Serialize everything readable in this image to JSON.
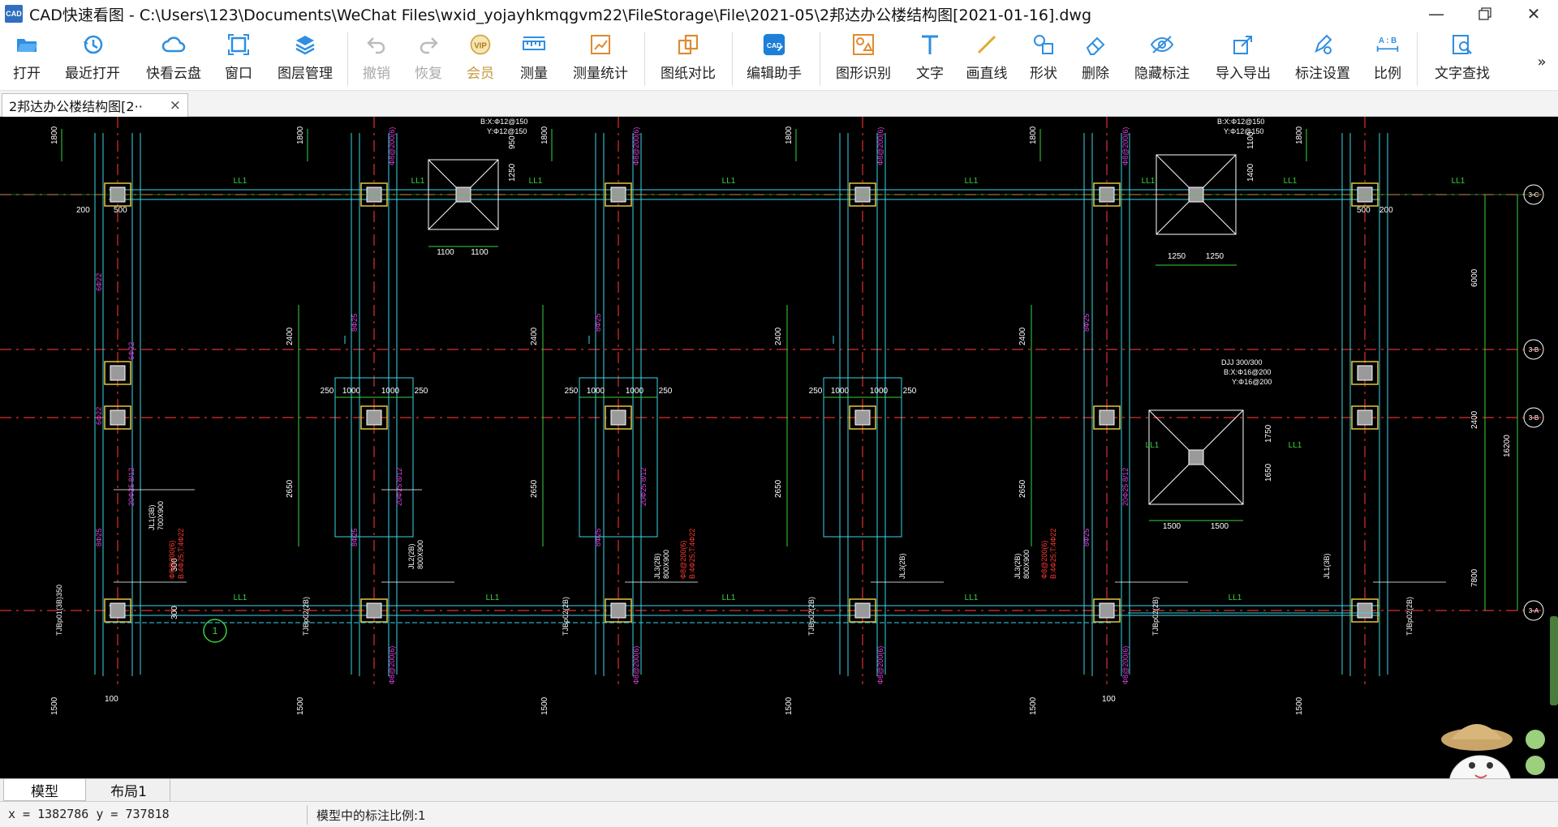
{
  "app": {
    "logo_text": "CAD",
    "title": "CAD快速看图 - C:\\Users\\123\\Documents\\WeChat Files\\wxid_yojayhkmqgvm22\\FileStorage\\File\\2021-05\\2邦达办公楼结构图[2021-01-16].dwg"
  },
  "toolbar": {
    "open": "打开",
    "recent": "最近打开",
    "cloud": "快看云盘",
    "window": "窗口",
    "layers": "图层管理",
    "undo": "撤销",
    "redo": "恢复",
    "vip_badge": "VIP",
    "vip": "会员",
    "measure": "测量",
    "measure_stats": "测量统计",
    "compare": "图纸对比",
    "edit_helper_badge": "CAD",
    "edit_helper": "编辑助手",
    "shape_recognize": "图形识别",
    "text": "文字",
    "line": "画直线",
    "shape": "形状",
    "delete": "删除",
    "hide_annot": "隐藏标注",
    "import_export": "导入导出",
    "annot_settings": "标注设置",
    "scale_badge": "A : B",
    "scale": "比例",
    "text_search": "文字查找",
    "more": "»"
  },
  "doc_tab": {
    "label": "2邦达办公楼结构图[2··",
    "close": "×"
  },
  "layout_tabs": [
    "模型",
    "布局1"
  ],
  "status": {
    "coords": "x = 1382786  y = 737818",
    "scale_text": "模型中的标注比例:1"
  },
  "drawing": {
    "axis_labels": [
      "3-C",
      "3-B",
      "3-B",
      "3-A"
    ],
    "beam_label": "LL1",
    "axis_bubble": "1",
    "dims": {
      "d1800": "1800",
      "d200": "200",
      "d500": "500",
      "d950": "950",
      "d1250": "1250",
      "d1100": "1100",
      "d250": "250",
      "d1000": "1000",
      "d2400": "2400",
      "d2650": "2650",
      "d1500": "1500",
      "d300": "300",
      "d100": "100",
      "d1400": "1400",
      "d1750": "1750",
      "d1650": "1650",
      "d6000": "6000",
      "d7800": "7800",
      "d16200": "16200"
    },
    "annotations": {
      "pile1_x": "B:X:Φ12@150",
      "pile1_y": "Y:Φ12@150",
      "pile2_x": "B:X:Φ12@150",
      "pile2_y": "Y:Φ12@150",
      "pile3_d": "DJJ 300/300",
      "pile3_x": "B:X:Φ16@200",
      "pile3_y": "Y:Φ16@200",
      "col_rebar": "Φ8@200(6)",
      "stirrup": "8Φ25",
      "jl1_a": "JL1(3B)",
      "jl1_b": "700X900",
      "jl2_a": "JL2(2B)",
      "jl2_b": "800X900",
      "jl3_a": "JL3(2B)",
      "jl3_b": "800X900",
      "tjb1": "TJBp01(3B)350",
      "tjb2": "TJBp02(2B)",
      "rebar_red1": "Φ8@200(6)",
      "rebar_red2": "B:4Φ25;T:4Φ22",
      "side": "6Φ22",
      "mid": "20Φ25 8/12"
    }
  }
}
